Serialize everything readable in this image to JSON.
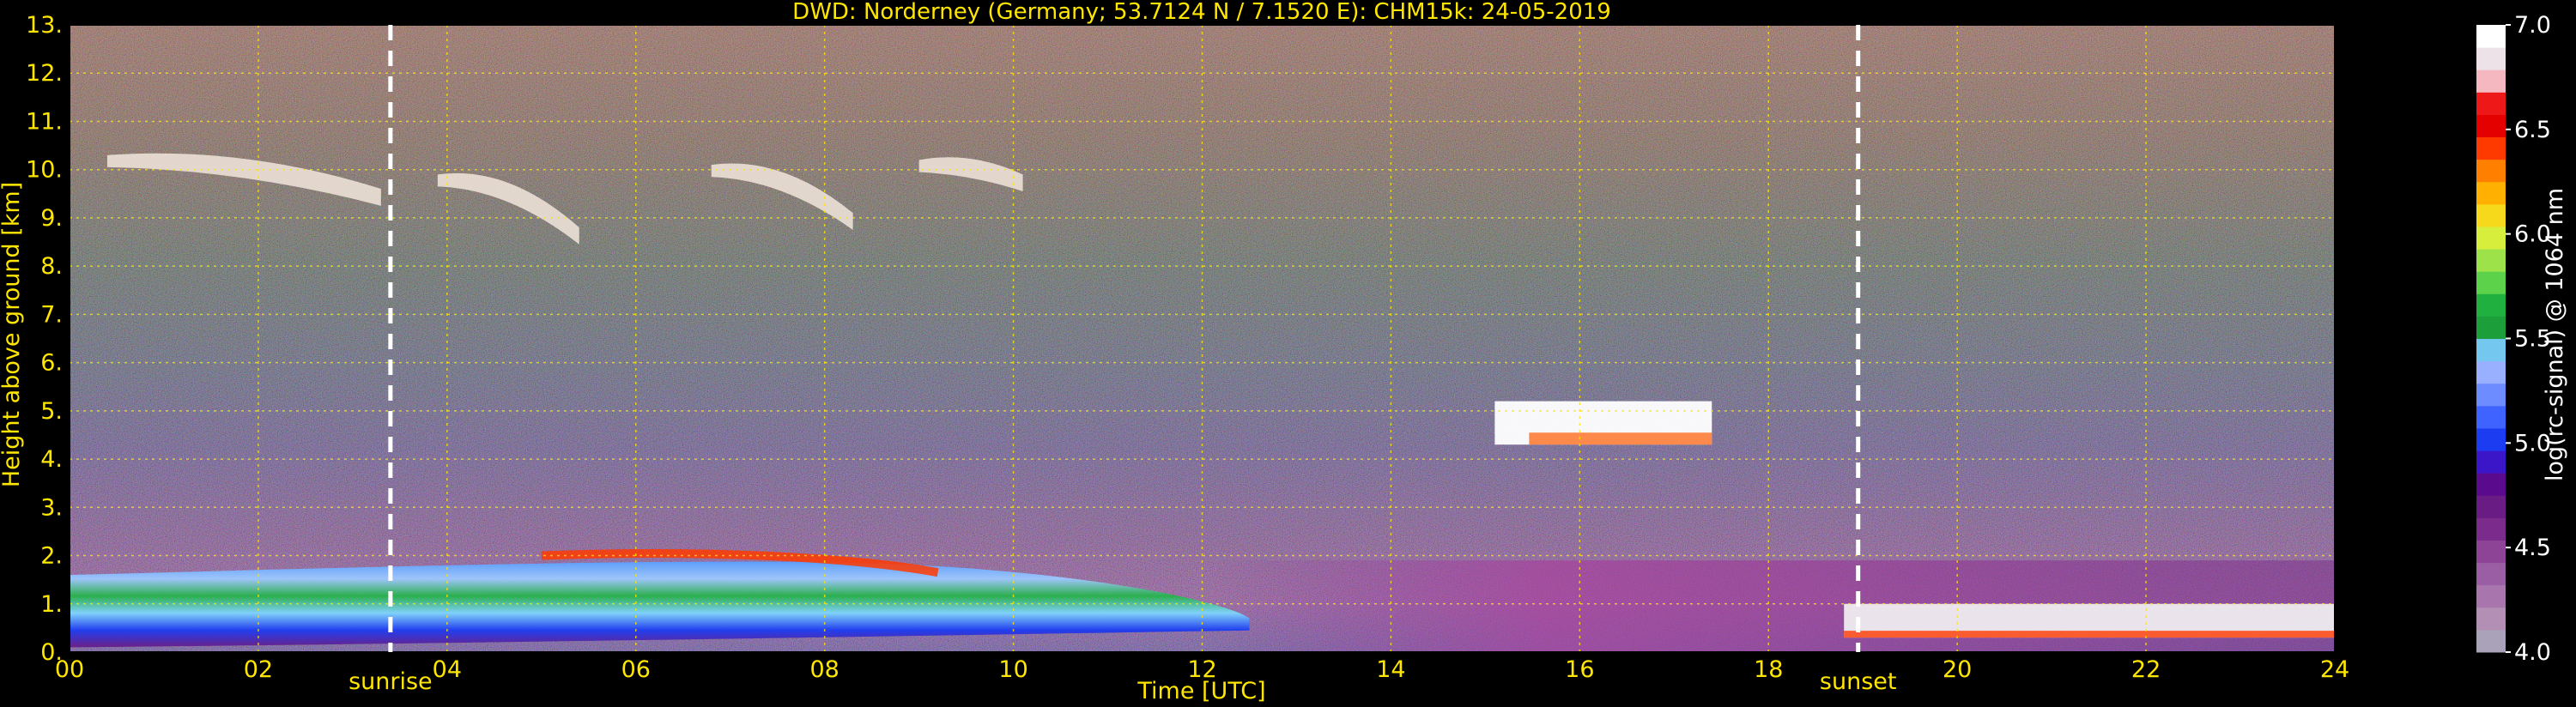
{
  "chart_data": {
    "type": "heatmap",
    "title": "DWD: Norderney (Germany; 53.7124 N / 7.1520 E):    CHM15k: 24-05-2019",
    "xlabel": "Time [UTC]",
    "ylabel": "Height above ground [km]",
    "xlim": [
      0,
      24
    ],
    "ylim": [
      0,
      13
    ],
    "x_ticks": [
      "00",
      "02",
      "04",
      "06",
      "08",
      "10",
      "12",
      "14",
      "16",
      "18",
      "20",
      "22",
      "24"
    ],
    "y_ticks": [
      "0.",
      "1.",
      "2.",
      "3.",
      "4.",
      "5.",
      "6.",
      "7.",
      "8.",
      "9.",
      "10.",
      "11.",
      "12.",
      "13."
    ],
    "grid": true,
    "colorbar": {
      "label": "log(rc-signal) @ 1064 nm",
      "range": [
        4.0,
        7.0
      ],
      "ticks": [
        "4.0",
        "4.5",
        "5.0",
        "5.5",
        "6.0",
        "6.5",
        "7.0"
      ],
      "colors": [
        "#a9a2b8",
        "#b48fb5",
        "#a876ad",
        "#9a5ea4",
        "#8e4496",
        "#7a2b8b",
        "#6a1c85",
        "#5a0a8c",
        "#3b16c8",
        "#1c3cf2",
        "#3f63ff",
        "#6c8cff",
        "#98b0ff",
        "#74c7ee",
        "#1c9e3a",
        "#20b040",
        "#5cd24a",
        "#9ee24a",
        "#d7ee3c",
        "#f7d91c",
        "#ffb000",
        "#ff7f00",
        "#ff3a00",
        "#e50000",
        "#ee1818",
        "#f5b8c0",
        "#ece2e8",
        "#ffffff"
      ]
    },
    "annotations": [
      {
        "text": "sunrise",
        "x": 3.4
      },
      {
        "text": "sunset",
        "x": 18.95
      }
    ],
    "features": [
      {
        "kind": "boundary_layer",
        "x_range": [
          0,
          12.5
        ],
        "height_km": [
          0.1,
          2.0
        ]
      },
      {
        "kind": "cirrus",
        "x_range": [
          0.4,
          10.1
        ],
        "height_km": [
          8.5,
          10.5
        ]
      },
      {
        "kind": "cloud_layer",
        "x_range": [
          15.1,
          17.4
        ],
        "height_km": [
          4.3,
          5.2
        ]
      },
      {
        "kind": "low_cloud",
        "x_range": [
          18.8,
          24
        ],
        "height_km": [
          0.3,
          1.0
        ]
      }
    ]
  }
}
